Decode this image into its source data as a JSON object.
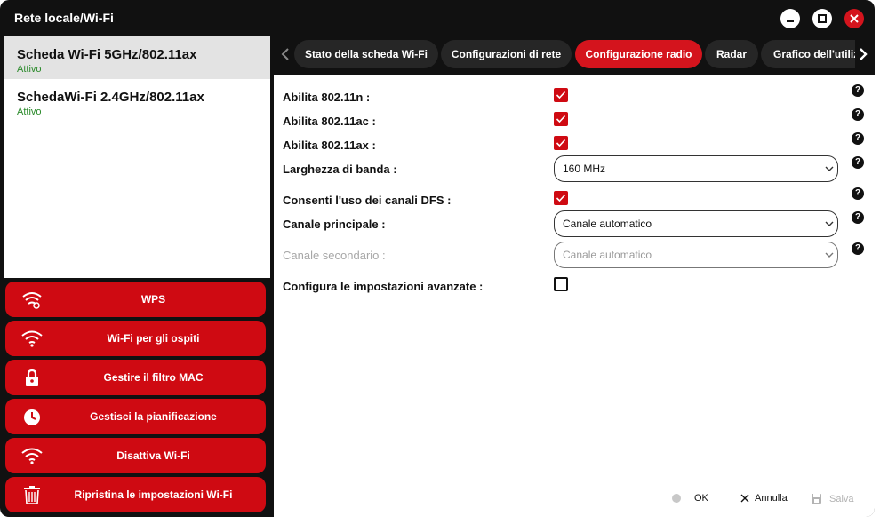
{
  "window": {
    "title": "Rete locale/Wi-Fi"
  },
  "title_buttons": {
    "minimize": "minimize-icon",
    "maximize": "maximize-icon",
    "close": "close-icon"
  },
  "adapters": [
    {
      "name": "Scheda Wi-Fi 5GHz/802.11ax",
      "status": "Attivo",
      "selected": true
    },
    {
      "name": "SchedaWi-Fi 2.4GHz/802.11ax",
      "status": "Attivo",
      "selected": false
    }
  ],
  "actions": [
    {
      "label": "WPS",
      "icon": "wps-wifi-icon"
    },
    {
      "label": "Wi-Fi per gli ospiti",
      "icon": "wifi-icon"
    },
    {
      "label": "Gestire il filtro MAC",
      "icon": "lock-icon"
    },
    {
      "label": "Gestisci la pianificazione",
      "icon": "clock-icon"
    },
    {
      "label": "Disattiva Wi-Fi",
      "icon": "wifi-icon"
    },
    {
      "label": "Ripristina le impostazioni Wi-Fi",
      "icon": "trash-icon"
    }
  ],
  "tabs": [
    {
      "label": "Stato della scheda Wi-Fi",
      "active": false
    },
    {
      "label": "Configurazioni di rete",
      "active": false
    },
    {
      "label": "Configurazione radio",
      "active": true
    },
    {
      "label": "Radar",
      "active": false
    },
    {
      "label": "Grafico dell'utiliz",
      "active": false
    }
  ],
  "settings": {
    "enable_11n": {
      "label": "Abilita 802.11n :",
      "checked": true
    },
    "enable_11ac": {
      "label": "Abilita 802.11ac :",
      "checked": true
    },
    "enable_11ax": {
      "label": "Abilita 802.11ax :",
      "checked": true
    },
    "bandwidth": {
      "label": "Larghezza di banda :",
      "value": "160 MHz"
    },
    "dfs": {
      "label": "Consenti l'uso dei canali DFS :",
      "checked": true
    },
    "primary_channel": {
      "label": "Canale principale :",
      "value": "Canale automatico"
    },
    "secondary_channel": {
      "label": "Canale secondario :",
      "value": "Canale automatico",
      "disabled": true
    },
    "advanced": {
      "label": "Configura le impostazioni avanzate :",
      "checked": false
    }
  },
  "help_icon": "question-icon",
  "footer": {
    "ok": "OK",
    "cancel": "Annulla",
    "save": "Salva"
  },
  "colors": {
    "accent": "#cf0a12",
    "dark": "#111111",
    "tab": "#262626",
    "status_green": "#2b8a2b"
  }
}
